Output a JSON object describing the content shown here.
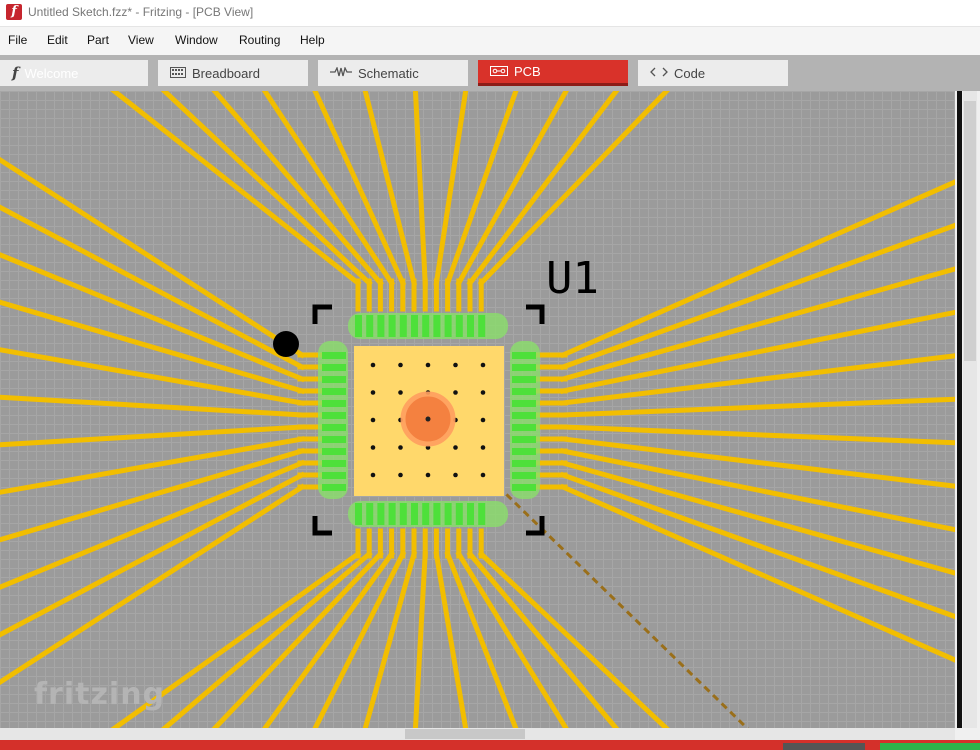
{
  "window": {
    "title": "Untitled Sketch.fzz* - Fritzing - [PCB View]",
    "app_icon_letter": "f"
  },
  "menu": [
    "File",
    "Edit",
    "Part",
    "View",
    "Window",
    "Routing",
    "Help"
  ],
  "tabs": [
    {
      "label": "Welcome",
      "icon": "fritzing-f-icon",
      "active": false
    },
    {
      "label": "Breadboard",
      "icon": "breadboard-icon",
      "active": false
    },
    {
      "label": "Schematic",
      "icon": "schematic-icon",
      "active": false
    },
    {
      "label": "PCB",
      "icon": "pcb-icon",
      "active": true
    },
    {
      "label": "Code",
      "icon": "code-icon",
      "active": false
    }
  ],
  "pcb": {
    "part_label": "U1",
    "watermark": "fritzing",
    "pads_per_side": 12,
    "colors": {
      "board": "#9b9b9b",
      "trace": "#f2be00",
      "pad": "#4ee03a",
      "chip_body": "#ffd86b",
      "via": "#f47a3d",
      "active_tab": "#d9322a",
      "ratsnest": "#9a6f1a"
    }
  }
}
